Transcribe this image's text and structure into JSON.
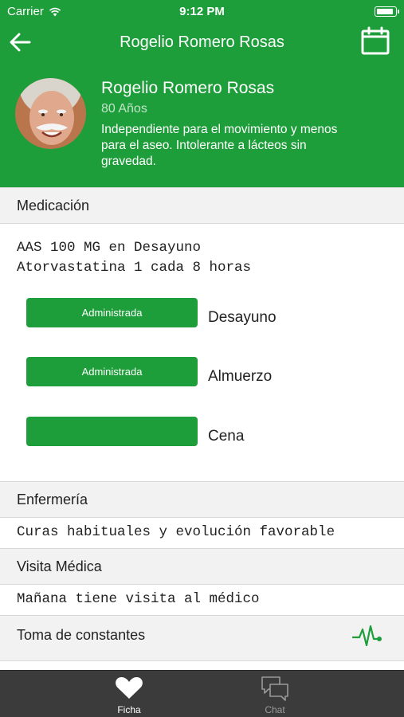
{
  "status_bar": {
    "carrier": "Carrier",
    "time": "9:12 PM",
    "battery_level": 0.95
  },
  "nav": {
    "title": "Rogelio Romero Rosas",
    "back_icon": "arrow-left-icon",
    "calendar_icon": "calendar-icon"
  },
  "profile": {
    "name": "Rogelio Romero Rosas",
    "age": "80 Años",
    "description_lines": [
      "Independiente para el movimiento y menos",
      "para el aseo. Intolerante a lácteos sin",
      "gravedad."
    ]
  },
  "medication": {
    "title": "Medicación",
    "lines": [
      "AAS 100 MG en Desayuno",
      "Atorvastatina 1 cada 8 horas"
    ],
    "doses": [
      {
        "button_label": "Administrada",
        "meal": "Desayuno"
      },
      {
        "button_label": "Administrada",
        "meal": "Almuerzo"
      },
      {
        "button_label": "",
        "meal": "Cena"
      }
    ]
  },
  "nursing": {
    "title": "Enfermería",
    "note": "Curas habituales y evolución favorable"
  },
  "medical_visit": {
    "title": "Visita Médica",
    "note": "Mañana tiene visita al médico"
  },
  "vitals": {
    "title": "Toma de constantes",
    "icon": "pulse-icon"
  },
  "tabbar": {
    "tabs": [
      {
        "label": "Ficha",
        "icon": "heart-icon",
        "active": true
      },
      {
        "label": "Chat",
        "icon": "chat-icon",
        "active": false
      }
    ]
  },
  "colors": {
    "primary": "#1e9e3a",
    "section_bg": "#f2f2f2",
    "tabbar_bg": "#3b3b3b",
    "tab_inactive": "#9a9a9a"
  }
}
